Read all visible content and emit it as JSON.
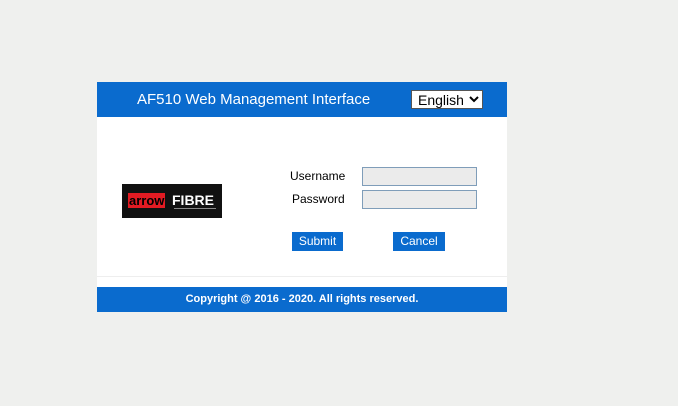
{
  "header": {
    "title": "AF510 Web Management Interface",
    "language": "English"
  },
  "logo": {
    "part1": "arrow",
    "part2": "FIBRE"
  },
  "form": {
    "username_label": "Username",
    "password_label": "Password",
    "username_value": "",
    "password_value": "",
    "submit_label": "Submit",
    "cancel_label": "Cancel"
  },
  "footer": {
    "copyright": "Copyright @ 2016 - 2020. All rights reserved."
  },
  "colors": {
    "accent": "#0a6bce",
    "background": "#eff0ee"
  }
}
